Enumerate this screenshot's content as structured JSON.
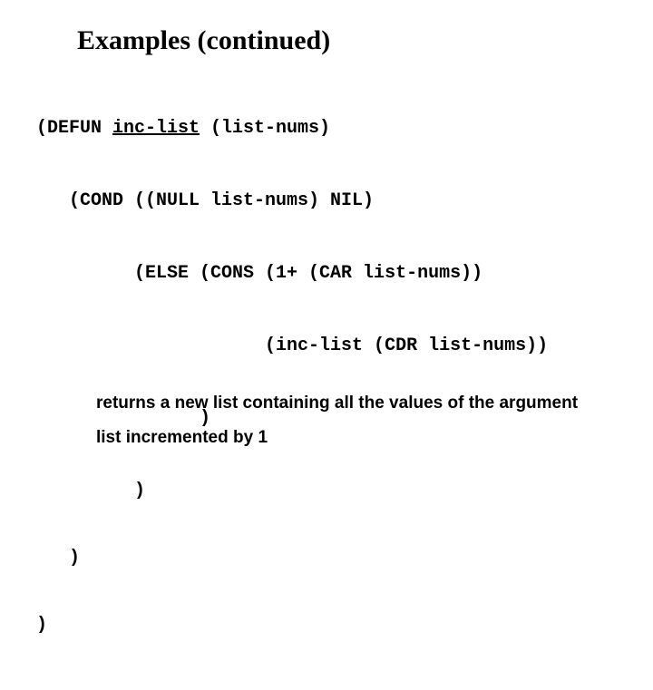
{
  "title": "Examples (continued)",
  "code": {
    "l1a": "(DEFUN ",
    "l1fn": "inc-list",
    "l1b": " (list-nums)",
    "l2": "   (COND ((NULL list-nums) NIL)",
    "l3": "         (ELSE (CONS (1+ (CAR list-nums))",
    "l4": "                     (inc-list (CDR list-nums))",
    "l5": "               )",
    "l6": "         )",
    "l7": "   )",
    "l8": ")"
  },
  "description": "returns a new list containing all the values of the argument list incremented by 1"
}
